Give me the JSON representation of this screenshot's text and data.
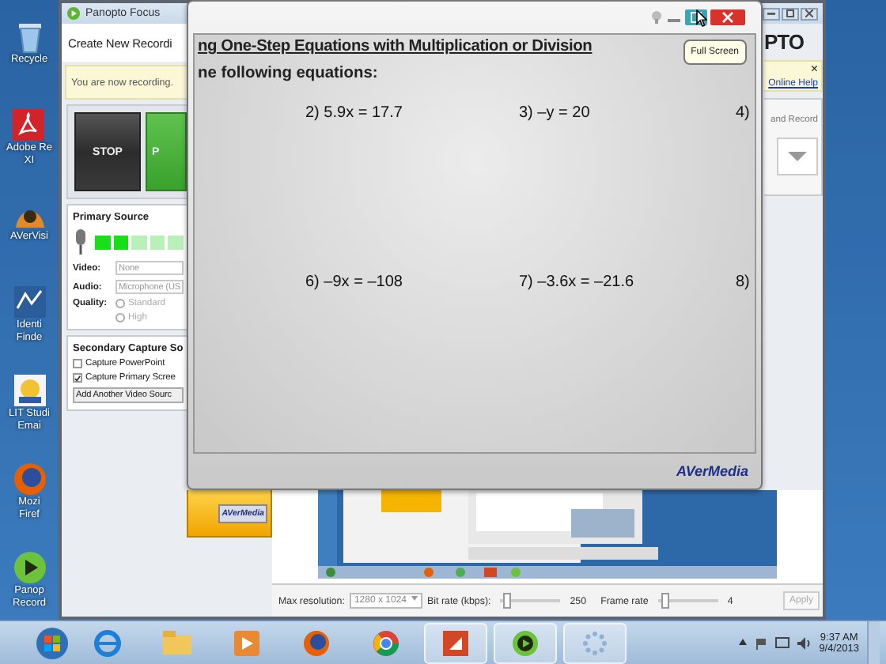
{
  "desktop_icons": [
    {
      "kind": "recycle",
      "lines": [
        "Recycle"
      ]
    },
    {
      "kind": "pdf",
      "lines": [
        "Adobe Re",
        "XI"
      ]
    },
    {
      "kind": "camera",
      "lines": [
        "AVerVisi"
      ]
    },
    {
      "kind": "finder",
      "lines": [
        "Identi",
        "Finde"
      ]
    },
    {
      "kind": "mail",
      "lines": [
        "LIT Studi",
        "Emai"
      ]
    },
    {
      "kind": "firefox",
      "lines": [
        "Mozi",
        "Firef"
      ]
    },
    {
      "kind": "play",
      "lines": [
        "Panop",
        "Record"
      ]
    }
  ],
  "panopto": {
    "title": "Panopto Focus",
    "heading": "Create New Recordi",
    "notice": "You are now recording.",
    "stop": "STOP",
    "pause": "P",
    "primary": {
      "title": "Primary Source",
      "level": 0.4,
      "video_label": "Video:",
      "video": "None",
      "audio_label": "Audio:",
      "audio": "Microphone (US",
      "quality_label": "Quality:",
      "qualities": [
        {
          "label": "Standard",
          "selected": false,
          "disabled": true
        },
        {
          "label": "High",
          "selected": false,
          "disabled": true
        }
      ]
    },
    "secondary": {
      "title": "Secondary Capture So",
      "options": [
        {
          "label": "Capture PowerPoint",
          "checked": false
        },
        {
          "label": "Capture Primary Scree",
          "checked": true
        }
      ],
      "add": "Add Another Video Sourc"
    },
    "logo": "PTO",
    "help_close": "×",
    "help_link": "Online Help",
    "record": "and Record",
    "settings": {
      "resolution_label": "Max resolution:",
      "resolution": "1280 x 1024",
      "bitrate_label": "Bit rate (kbps):",
      "bitrate_slider": {
        "level": 0.1
      },
      "bitrate": "250",
      "framerate_label": "Frame rate",
      "framerate_slider": {
        "level": 0.1
      },
      "framerate": "4",
      "apply": "Apply"
    },
    "tab_brand": "AVerMedia"
  },
  "camera": {
    "heading": "ng One-Step Equations with Multiplication or Division",
    "instruction": "ne following equations:",
    "equations": [
      "2) 5.9x = 17.7",
      "3) –y = 20",
      "4)",
      "6) –9x = –108",
      "7) –3.6x = –21.6",
      "8)"
    ],
    "brand": "AVerMedia",
    "tooltip": "Full Screen"
  },
  "taskbar": {
    "time": "9:37 AM",
    "date": "9/4/2013"
  }
}
